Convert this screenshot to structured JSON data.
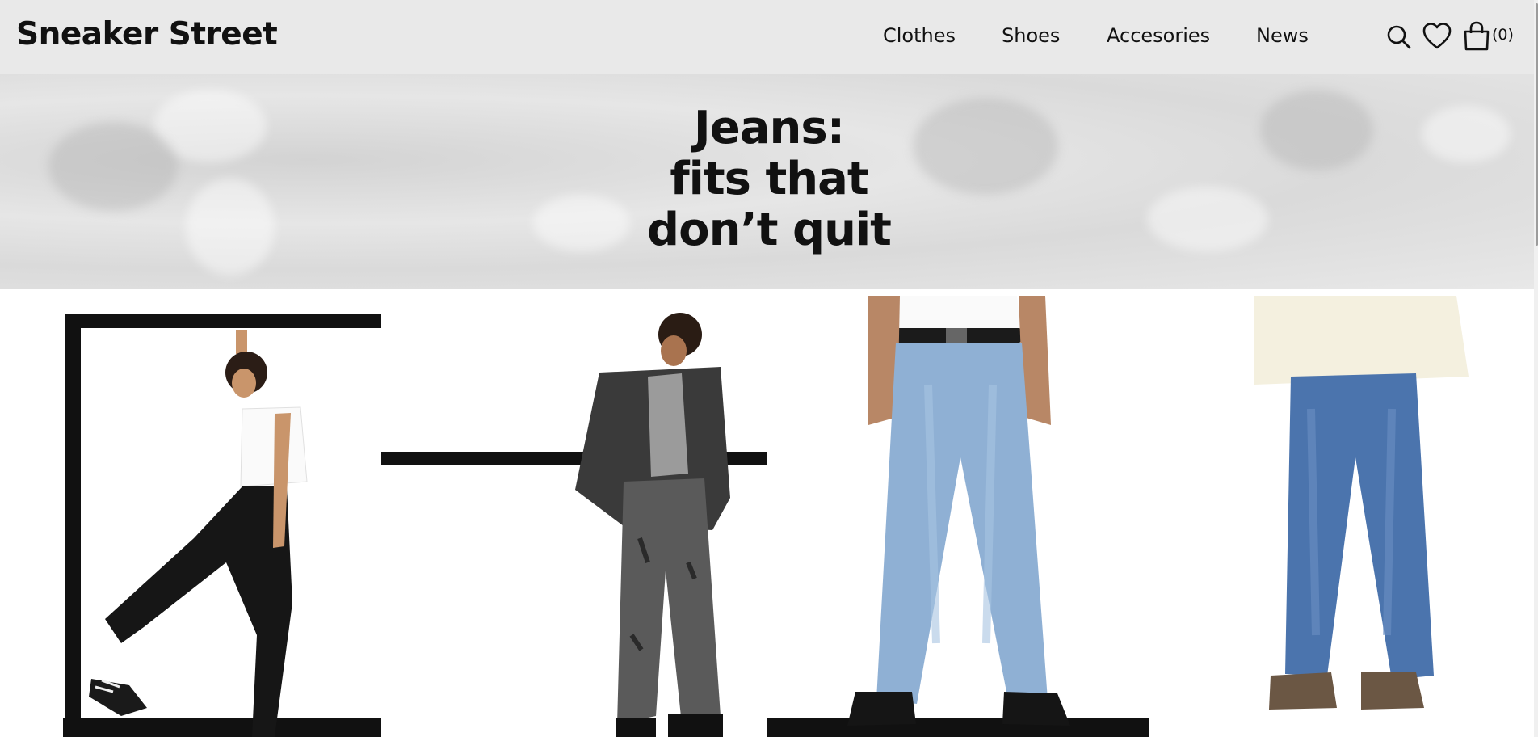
{
  "header": {
    "brand": "Sneaker Street",
    "nav": [
      {
        "label": "Clothes"
      },
      {
        "label": "Shoes"
      },
      {
        "label": "Accesories"
      },
      {
        "label": "News"
      }
    ],
    "icons": {
      "search": "search-icon",
      "wishlist": "heart-icon",
      "cart": "shopping-bag-icon"
    },
    "cart_count": "(0)"
  },
  "hero": {
    "lines": [
      "Jeans:",
      "fits that",
      "don’t quit"
    ]
  },
  "gallery": {
    "tiles": [
      {
        "name": "model-black-jeans-frame"
      },
      {
        "name": "model-grey-distressed-jeans"
      },
      {
        "name": "model-light-blue-jeans"
      },
      {
        "name": "model-mid-blue-jeans"
      }
    ]
  },
  "colors": {
    "header_bg": "#e9e9e9",
    "text": "#111111"
  }
}
